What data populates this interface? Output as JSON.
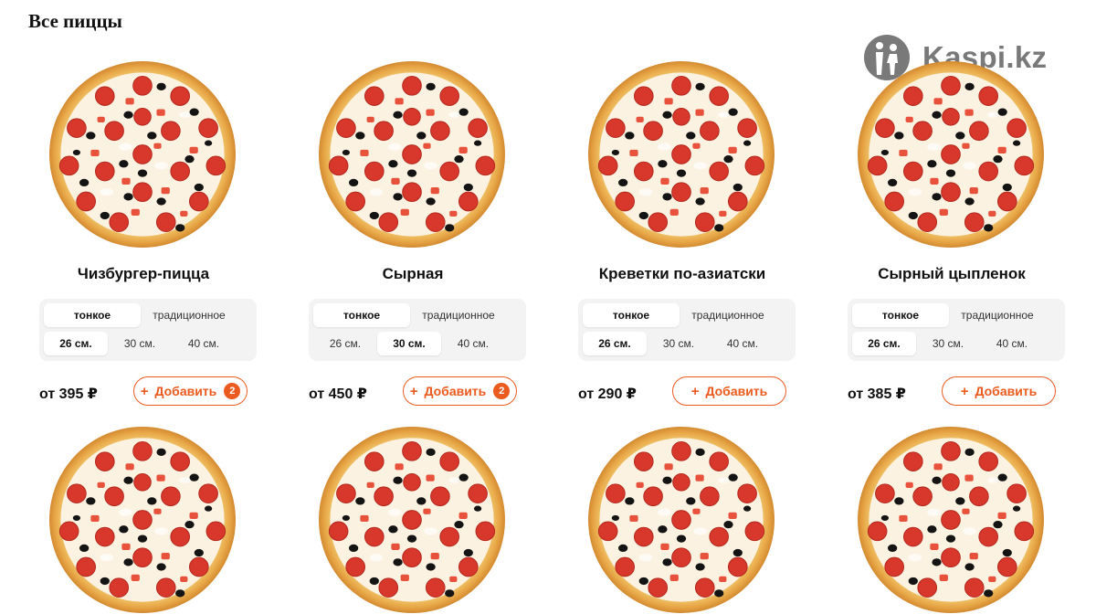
{
  "page": {
    "title": "Все пиццы"
  },
  "watermark": {
    "text": "Kaspi.kz"
  },
  "options": {
    "dough": [
      "тонкое",
      "традиционное"
    ],
    "sizes": [
      "26 см.",
      "30 см.",
      "40 см."
    ]
  },
  "colors": {
    "accent": "#eb5a1e",
    "options_bg": "#f3f3f3"
  },
  "products": [
    {
      "name": "Чизбургер-пицца",
      "price": "от 395 ₽",
      "add_label": "Добавить",
      "count": "2",
      "selected_dough": 0,
      "selected_size": 0
    },
    {
      "name": "Сырная",
      "price": "от 450 ₽",
      "add_label": "Добавить",
      "count": "2",
      "selected_dough": 0,
      "selected_size": 1
    },
    {
      "name": "Креветки по-азиатски",
      "price": "от 290 ₽",
      "add_label": "Добавить",
      "count": "",
      "selected_dough": 0,
      "selected_size": 0
    },
    {
      "name": "Сырный цыпленок",
      "price": "от 385 ₽",
      "add_label": "Добавить",
      "count": "",
      "selected_dough": 0,
      "selected_size": 0
    }
  ]
}
